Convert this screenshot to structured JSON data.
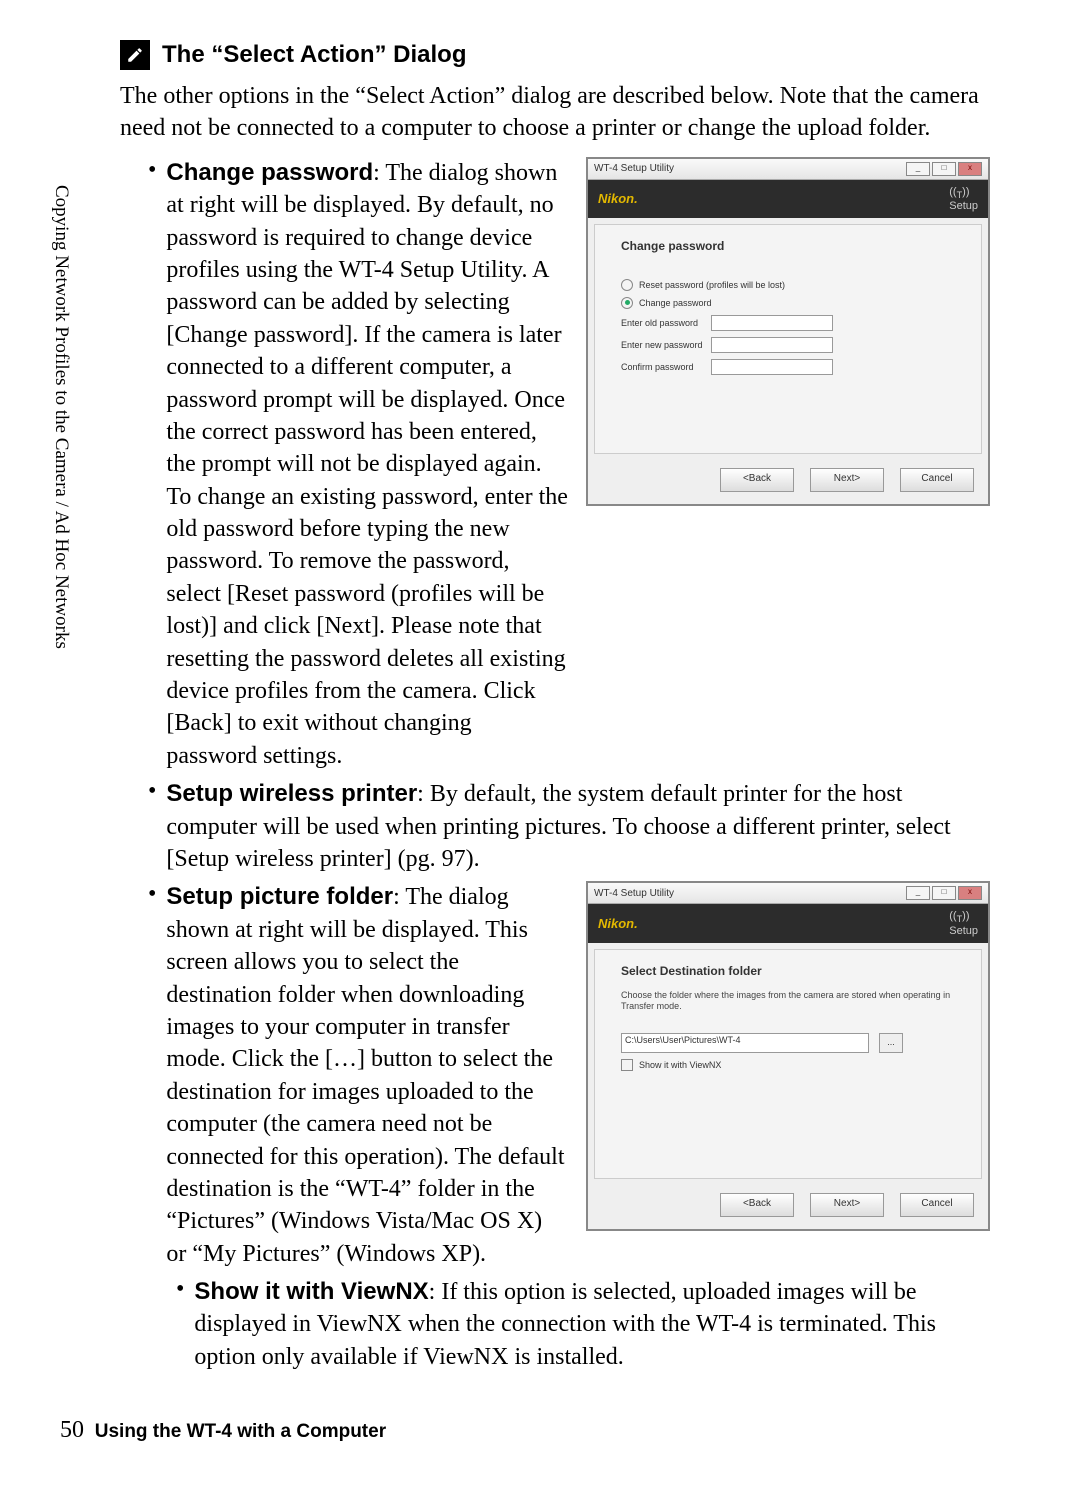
{
  "sidebar": "Copying Network Profiles to the Camera / Ad Hoc Networks",
  "title": "The “Select Action” Dialog",
  "intro": "The other options in the “Select Action” dialog are described below. Note that the camera need not be connected to a computer to choose a printer or change the upload folder.",
  "bullets": {
    "change_pw_label": "Change password",
    "change_pw_text": ": The dialog shown at right will be displayed. By default, no password is required to change device profiles using the WT-4 Setup Utility. A password can be added by selecting [Change password]. If the camera is later connected to a different computer, a password prompt will be displayed. Once the correct password has been entered, the prompt will not be displayed again. To change an existing password, enter the old password before typing the new password. To remove the password, select [Reset password (profiles will be lost)] and click [Next]. Please note that resetting the password deletes all existing device profiles from the camera. Click [Back] to exit without changing password settings.",
    "wireless_label": "Setup wireless printer",
    "wireless_text": ": By default, the system default printer for the host computer will be used when printing pictures. To choose a different printer, select [Setup wireless printer] (pg. 97).",
    "folder_label": "Setup picture folder",
    "folder_text": ": The dialog shown at right will be displayed. This screen allows you to select the destination folder when downloading images to your computer in transfer mode. Click the […] button to select the destination for images uploaded to the computer (the camera need not be connected for this operation). The default destination is the “WT-4” folder in the “Pictures” (Windows Vista/Mac OS X) or “My Pictures” (Windows XP).",
    "viewnx_label": "Show it with ViewNX",
    "viewnx_text": ": If this option is selected, uploaded images will be displayed in ViewNX when the connection with the WT-4 is terminated. This option only available if ViewNX is installed."
  },
  "dialog1": {
    "win_title": "WT-4 Setup Utility",
    "brand": "Nikon.",
    "setup": "Setup",
    "heading": "Change password",
    "radio_reset": "Reset password (profiles will be lost)",
    "radio_change": "Change password",
    "field_old": "Enter old password",
    "field_new": "Enter new password",
    "field_confirm": "Confirm password",
    "btn_back": "<Back",
    "btn_next": "Next>",
    "btn_cancel": "Cancel"
  },
  "dialog2": {
    "win_title": "WT-4 Setup Utility",
    "brand": "Nikon.",
    "setup": "Setup",
    "heading": "Select Destination folder",
    "instr": "Choose the folder where the images from the camera are stored when operating in Transfer mode.",
    "path": "C:\\Users\\User\\Pictures\\WT-4",
    "browse": "...",
    "check_viewnx": "Show it with ViewNX",
    "btn_back": "<Back",
    "btn_next": "Next>",
    "btn_cancel": "Cancel"
  },
  "footer": {
    "page": "50",
    "text": "Using the WT-4 with a Computer"
  }
}
